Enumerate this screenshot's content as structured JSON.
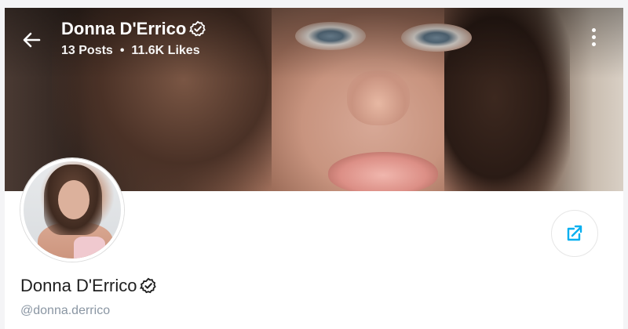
{
  "header": {
    "name": "Donna D'Errico",
    "posts": "13 Posts",
    "likes": "11.6K Likes",
    "separator": "•"
  },
  "profile": {
    "name": "Donna D'Errico",
    "handle": "@donna.derrico"
  },
  "icons": {
    "back": "arrow-left-icon",
    "verified": "verified-badge-icon",
    "menu": "more-vertical-icon",
    "share": "share-icon"
  },
  "colors": {
    "accent": "#00aff0",
    "handle": "#8a96a3",
    "text": "#1e1e1e"
  }
}
